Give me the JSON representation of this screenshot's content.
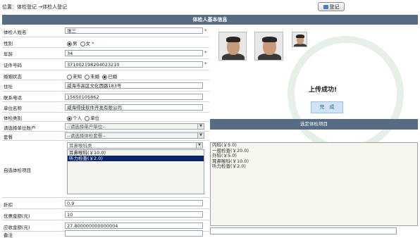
{
  "header": {
    "breadcrumb": "位置：体检登记 →体检人登记",
    "register_button": "登记"
  },
  "title": "体检人基本信息",
  "form": {
    "name_label": "体检人姓名",
    "name_value": "张三",
    "gender_label": "性别",
    "gender_male": "男",
    "gender_female": "女",
    "age_label": "年龄",
    "age_value": "34",
    "id_label": "证件号码",
    "id_value": "371002198204023210",
    "marital_label": "婚姻状态",
    "marital_unknown": "未知",
    "marital_single": "未婚",
    "marital_married": "已婚",
    "address_label": "住址",
    "address_value": "威海市高区文化西路183号",
    "phone_label": "联系电话",
    "phone_value": "15650105862",
    "company_label": "单位名称",
    "company_value": "威海得佳软件开发有限公司",
    "category_label": "体检类别",
    "category_personal": "个人",
    "category_unit": "单位",
    "unit_account_label": "请选择单位账户",
    "unit_account_value": "--请选择单户单位--",
    "package_label": "套餐",
    "package_value": "--请选择体检套餐--",
    "self_select_label": "自选体检项目",
    "dept_select": "耳鼻喉科类",
    "items": [
      "耳鼻喉科(￥10.0)",
      "听力检查(￥2.0)"
    ],
    "discount_label": "折扣",
    "discount_value": "0.9",
    "preferential_label": "优惠金额(元)",
    "preferential_value": "10",
    "receivable_label": "应收金额(元)",
    "receivable_value": "27.800000000000004",
    "remark_label": "备注"
  },
  "right": {
    "upload_success": "上传成功!",
    "done_button": "完　成",
    "selected_title": "选定体检项目",
    "selected_items": [
      "内科(￥5.0)",
      "一般检查(￥20.0)",
      "外科(￥5.0)",
      "耳鼻喉科(￥10.0)",
      "听力检查(￥2.0)"
    ]
  }
}
